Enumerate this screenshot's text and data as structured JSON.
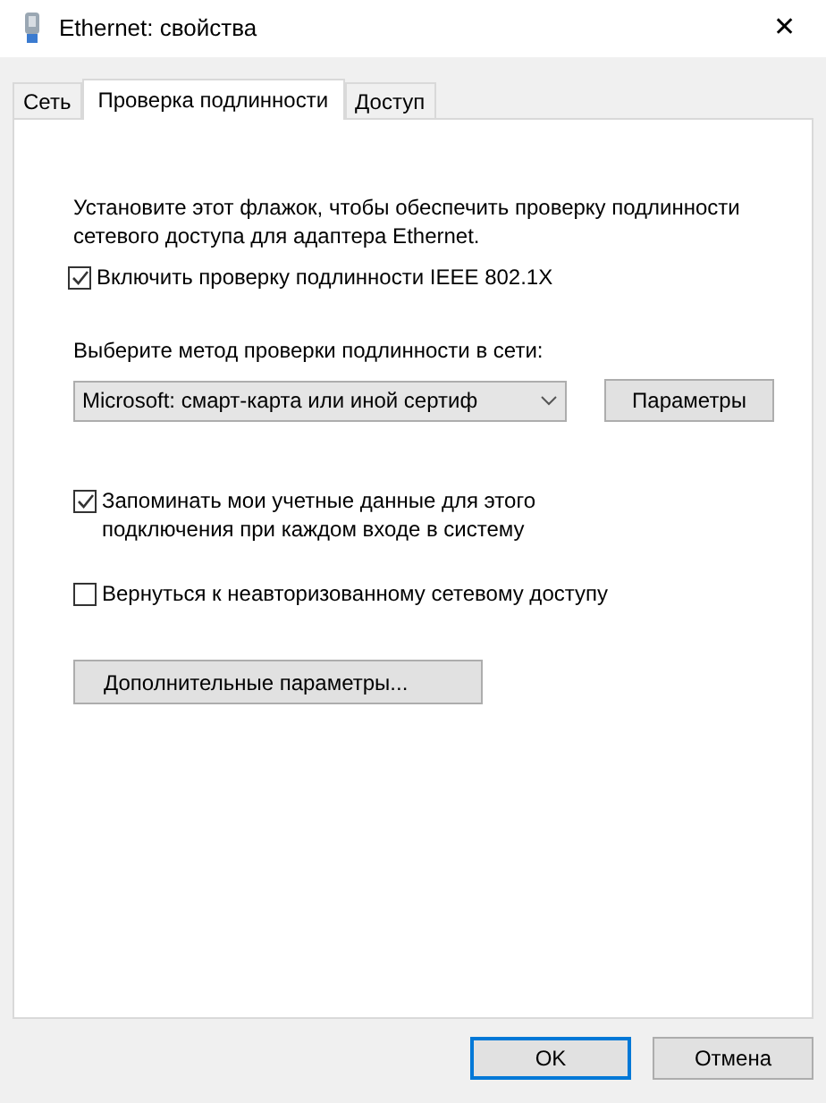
{
  "window": {
    "title": "Ethernet: свойства",
    "close": "✕"
  },
  "tabs": [
    {
      "label": "Сеть",
      "selected": false
    },
    {
      "label": "Проверка подлинности",
      "selected": true
    },
    {
      "label": "Доступ",
      "selected": false
    }
  ],
  "intro": "Установите этот флажок, чтобы обеспечить проверку подлинности сетевого доступа для адаптера Ethernet.",
  "enable": {
    "label": "Включить проверку подлинности IEEE 802.1X",
    "checked": true
  },
  "method": {
    "label": "Выберите метод проверки подлинности в сети:",
    "value": "Microsoft: смарт-карта или иной сертиф",
    "button": "Параметры"
  },
  "options": [
    {
      "label": "Запоминать мои учетные данные для этого подключения при каждом входе в систему",
      "checked": true
    },
    {
      "label": "Вернуться к неавторизованному сетевому доступу",
      "checked": false
    }
  ],
  "advanced_button": "Дополнительные параметры...",
  "buttons": [
    {
      "label": "OK",
      "default": true
    },
    {
      "label": "Отмена",
      "default": false
    }
  ]
}
